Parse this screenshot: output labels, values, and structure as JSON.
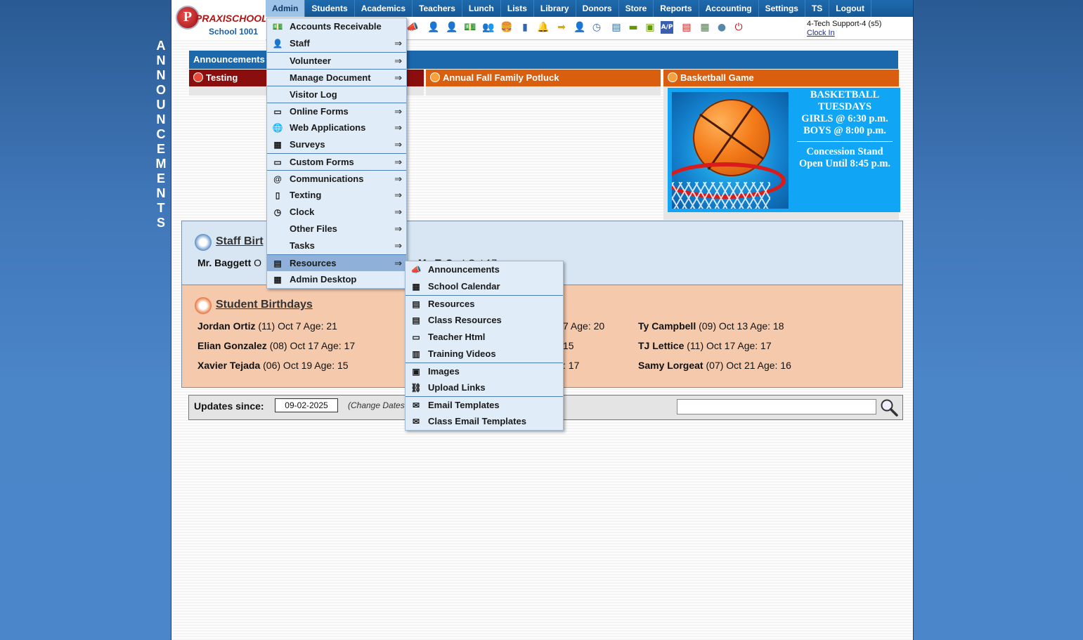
{
  "side_label": [
    "A",
    "N",
    "N",
    "O",
    "U",
    "N",
    "C",
    "E",
    "M",
    "E",
    "N",
    "T",
    "S"
  ],
  "logo": {
    "brand_a": "PRAXI",
    "brand_b": "SCHOOL",
    "tm": "™",
    "school": "School 1001",
    "initial": "P"
  },
  "nav": [
    "Admin",
    "Students",
    "Academics",
    "Teachers",
    "Lunch",
    "Lists",
    "Library",
    "Donors",
    "Store",
    "Reports",
    "Accounting",
    "Settings",
    "TS",
    "Logout"
  ],
  "user": {
    "name": "4-Tech Support-4 (s5)",
    "clock_link": "Clock In"
  },
  "announcements": {
    "header": "Announcements",
    "tabs": [
      "Testing",
      "Annual Fall Family Potluck",
      "Basketball Game"
    ],
    "basketball": {
      "line1": "BASKETBALL",
      "line2": "TUESDAYS",
      "line3": "GIRLS @ 6:30 p.m.",
      "line4": "BOYS  @ 8:00 p.m.",
      "line5": "Concession Stand",
      "line6": "Open Until 8:45 p.m."
    }
  },
  "staff_birthdays": {
    "title": "Staff Birthdays",
    "title_visible": "Staff Birt",
    "entries": [
      {
        "name": "Mr. Baggett",
        "rest": "O"
      },
      {
        "name": "Mr. T. Cart",
        "rest": "Oct 17"
      }
    ]
  },
  "student_birthdays": {
    "title": "Student Birthdays",
    "entries": [
      {
        "name": "Jordan Ortiz",
        "rest": " (11) Oct 7 Age: 21"
      },
      {
        "name": "Elian Gonzalez",
        "rest": " (08) Oct 17 Age: 17"
      },
      {
        "name": "Xavier Tejada",
        "rest": " (06) Oct 19 Age: 15"
      },
      {
        "name": "",
        "rest": "7 Age: 20"
      },
      {
        "name": "",
        "rest": "15"
      },
      {
        "name": "",
        "rest": ": 17"
      },
      {
        "name": "Ty Campbell",
        "rest": " (09) Oct 13 Age: 18"
      },
      {
        "name": "TJ Lettice",
        "rest": " (11) Oct 17 Age: 17"
      },
      {
        "name": "Samy Lorgeat",
        "rest": " (07) Oct 21 Age: 16"
      }
    ]
  },
  "updates": {
    "label": "Updates since:",
    "date": "09-02-2025",
    "change": "(Change Dates"
  },
  "admin_menu": [
    {
      "label": "Accounts Receivable",
      "icon": "money-icon",
      "glyph": "💵",
      "arrow": false,
      "sep": false
    },
    {
      "label": "Staff",
      "icon": "staff-icon",
      "glyph": "👤",
      "arrow": true,
      "sep": false
    },
    {
      "label": "Volunteer",
      "icon": "",
      "glyph": "",
      "arrow": true,
      "sep": true
    },
    {
      "label": "Manage Document",
      "icon": "",
      "glyph": "",
      "arrow": true,
      "sep": true
    },
    {
      "label": "Visitor Log",
      "icon": "",
      "glyph": "",
      "arrow": false,
      "sep": true
    },
    {
      "label": "Online Forms",
      "icon": "html-icon",
      "glyph": "▭",
      "arrow": true,
      "sep": true
    },
    {
      "label": "Web Applications",
      "icon": "globe-icon",
      "glyph": "🌐",
      "arrow": true,
      "sep": false
    },
    {
      "label": "Surveys",
      "icon": "survey-icon",
      "glyph": "▦",
      "arrow": true,
      "sep": false
    },
    {
      "label": "Custom Forms",
      "icon": "html-icon",
      "glyph": "▭",
      "arrow": true,
      "sep": true
    },
    {
      "label": "Communications",
      "icon": "at-icon",
      "glyph": "@",
      "arrow": true,
      "sep": true
    },
    {
      "label": "Texting",
      "icon": "phone-icon",
      "glyph": "▯",
      "arrow": true,
      "sep": false
    },
    {
      "label": "Clock",
      "icon": "clock-icon",
      "glyph": "◷",
      "arrow": true,
      "sep": false
    },
    {
      "label": "Other Files",
      "icon": "",
      "glyph": "",
      "arrow": true,
      "sep": false
    },
    {
      "label": "Tasks",
      "icon": "",
      "glyph": "",
      "arrow": true,
      "sep": false
    },
    {
      "label": "Resources",
      "icon": "resources-icon",
      "glyph": "▤",
      "arrow": true,
      "sep": true,
      "hl": true
    },
    {
      "label": "Admin Desktop",
      "icon": "desktop-icon",
      "glyph": "▦",
      "arrow": false,
      "sep": false
    }
  ],
  "arrow_glyph": "⇒",
  "resources_menu": [
    {
      "label": "Announcements",
      "icon": "megaphone-icon",
      "glyph": "📣",
      "sep": false
    },
    {
      "label": "School Calendar",
      "icon": "calendar-icon",
      "glyph": "▦",
      "sep": false
    },
    {
      "label": "Resources",
      "icon": "pdf-icon",
      "glyph": "▤",
      "sep": true
    },
    {
      "label": "Class Resources",
      "icon": "pdf-icon",
      "glyph": "▤",
      "sep": false
    },
    {
      "label": "Teacher Html",
      "icon": "html-icon",
      "glyph": "▭",
      "sep": false
    },
    {
      "label": "Training Videos",
      "icon": "film-icon",
      "glyph": "▥",
      "sep": false
    },
    {
      "label": "Images",
      "icon": "images-icon",
      "glyph": "▣",
      "sep": true
    },
    {
      "label": "Upload Links",
      "icon": "link-icon",
      "glyph": "⛓",
      "sep": false
    },
    {
      "label": "Email Templates",
      "icon": "email-icon",
      "glyph": "✉",
      "sep": true
    },
    {
      "label": "Class Email Templates",
      "icon": "email-icon",
      "glyph": "✉",
      "sep": false
    }
  ],
  "colors": {
    "nav_bg": "#1e6aad",
    "ann_dark_red": "#8a0e0e",
    "ann_orange": "#d95f0e",
    "bball_blue": "#10a6f5",
    "staff_bg": "#d8e6f4",
    "student_bg": "#f5c9ac"
  }
}
